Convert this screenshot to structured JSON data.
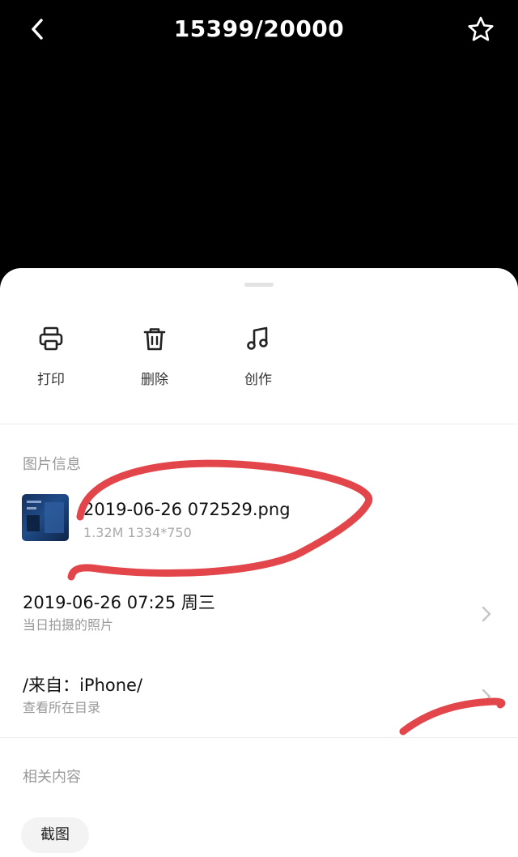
{
  "header": {
    "counter": "15399/20000",
    "back_icon": "chevron-left-icon",
    "favorite_icon": "star-icon"
  },
  "actions": [
    {
      "label": "打印",
      "icon": "printer-icon"
    },
    {
      "label": "删除",
      "icon": "trash-icon"
    },
    {
      "label": "创作",
      "icon": "music-note-icon"
    }
  ],
  "image_info": {
    "section_title": "图片信息",
    "file_name": "2019-06-26 072529.png",
    "file_meta": "1.32M 1334*750"
  },
  "date_row": {
    "main": "2019-06-26 07:25 周三",
    "sub": "当日拍摄的照片"
  },
  "source_row": {
    "main": "/来自：iPhone/",
    "sub": "查看所在目录"
  },
  "related": {
    "section_title": "相关内容",
    "tag": "截图"
  },
  "colors": {
    "background": "#000000",
    "sheet": "#ffffff",
    "annotation_red": "#e2464a",
    "muted_text": "#999999"
  }
}
